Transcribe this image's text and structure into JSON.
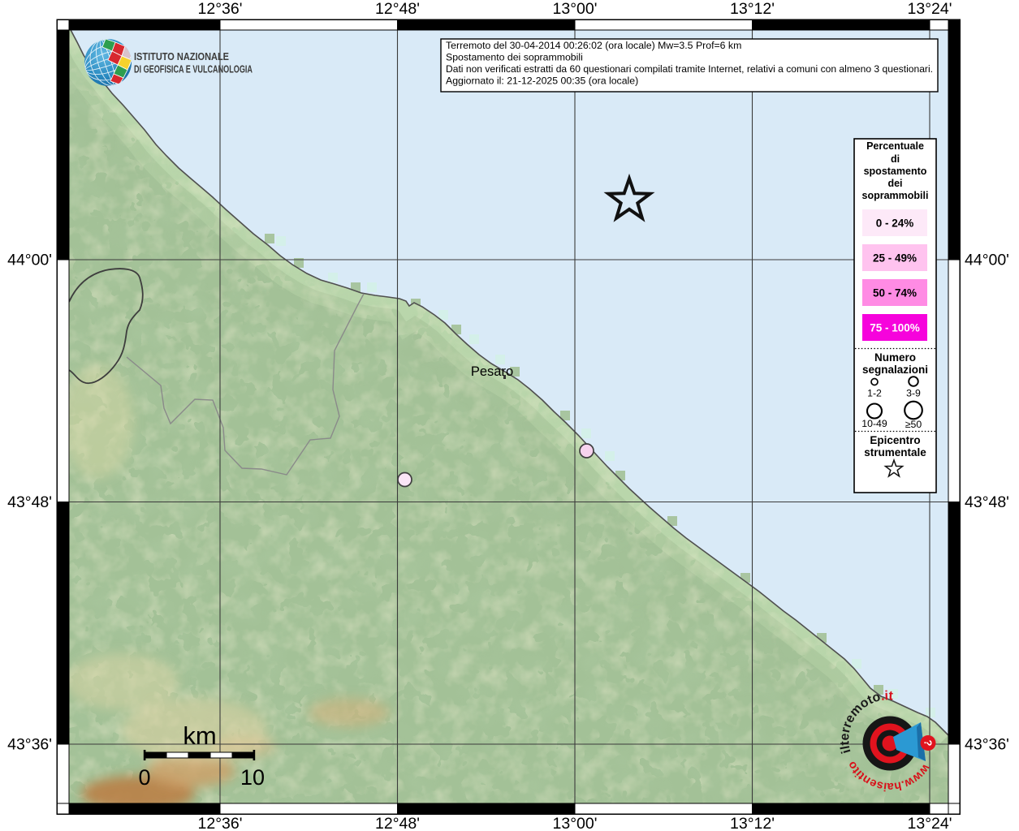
{
  "branding": {
    "ingv": {
      "line1": "ISTITUTO NAZIONALE",
      "line2": "DI GEOFISICA E VULCANOLOGIA"
    },
    "hsit": {
      "arc_top": "ilterremoto",
      "arc_top_suffix": ".it",
      "arc_bottom": "www.haisentito",
      "badge": "?"
    }
  },
  "info_box": {
    "line1": "Terremoto del 30-04-2014 00:26:02 (ora locale) Mw=3.5 Prof=6 km",
    "line2": "Spostamento dei soprammobili",
    "line3": "Dati non verificati estratti da 60 questionari compilati tramite Internet, relativi a comuni con almeno 3 questionari.",
    "line4": "Aggiornato il: 21-12-2025 00:35 (ora locale)"
  },
  "axes": {
    "top": [
      "12°36'",
      "12°48'",
      "13°00'",
      "13°12'",
      "13°24'"
    ],
    "bottom": [
      "12°36'",
      "12°48'",
      "13°00'",
      "13°12'",
      "13°24'"
    ],
    "left": [
      "44°00'",
      "43°48'",
      "43°36'"
    ],
    "right": [
      "44°00'",
      "43°48'",
      "43°36'"
    ]
  },
  "legend": {
    "title_lines": [
      "Percentuale",
      "di",
      "spostamento",
      "dei",
      "soprammobili"
    ],
    "classes": [
      {
        "label": "0 - 24%",
        "color": "#FDE9F8",
        "text_color": "#000000"
      },
      {
        "label": "25 - 49%",
        "color": "#FFC3EF",
        "text_color": "#000000"
      },
      {
        "label": "50 - 74%",
        "color": "#FF8BE4",
        "text_color": "#000000"
      },
      {
        "label": "75 - 100%",
        "color": "#F603DC",
        "text_color": "#FFFFFF"
      }
    ],
    "counts_title_lines": [
      "Numero",
      "segnalazioni"
    ],
    "count_labels": [
      "1-2",
      "3-9",
      "10-49",
      "≥50"
    ],
    "epicenter_title_lines": [
      "Epicentro",
      "strumentale"
    ]
  },
  "map": {
    "city": "Pesaro",
    "scalebar": {
      "unit": "km",
      "zero": "0",
      "ten": "10"
    },
    "report_colors": [
      "#F7D3EE",
      "#FAE5F6"
    ],
    "sea_color": "#D9EAF7",
    "land_color": "#A3C197"
  }
}
